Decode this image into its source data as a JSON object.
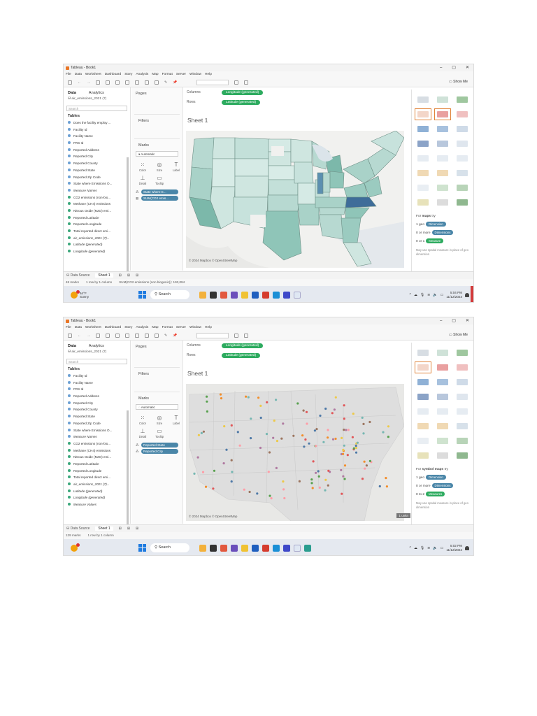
{
  "screens": [
    {
      "window_title": "Tableau - Book1",
      "menu": [
        "File",
        "Data",
        "Worksheet",
        "Dashboard",
        "Story",
        "Analysis",
        "Map",
        "Format",
        "Server",
        "Window",
        "Help"
      ],
      "show_me_label": "Show Me",
      "tabs": {
        "data": "Data",
        "analytics": "Analytics"
      },
      "datasource": "air_emissions_2021 (7)",
      "search_placeholder": "Search",
      "tables_header": "Tables",
      "fields": [
        {
          "label": "Does the facility employ ...",
          "kind": "dim",
          "italic": false
        },
        {
          "label": "Facility Id",
          "kind": "dim",
          "italic": false
        },
        {
          "label": "Facility Name",
          "kind": "dim",
          "italic": false
        },
        {
          "label": "FRS Id",
          "kind": "dim",
          "italic": false
        },
        {
          "label": "Reported Address",
          "kind": "dim",
          "italic": false
        },
        {
          "label": "Reported City",
          "kind": "dim",
          "italic": false
        },
        {
          "label": "Reported County",
          "kind": "dim",
          "italic": false
        },
        {
          "label": "Reported State",
          "kind": "dim",
          "italic": false
        },
        {
          "label": "Reported Zip Code",
          "kind": "dim",
          "italic": false
        },
        {
          "label": "State where Emissions O...",
          "kind": "dim",
          "italic": false
        },
        {
          "label": "Measure Names",
          "kind": "dim",
          "italic": true
        },
        {
          "label": "CO2 emissions (non-bio...",
          "kind": "meas",
          "italic": false
        },
        {
          "label": "Methane (CH4) emissions",
          "kind": "meas",
          "italic": false
        },
        {
          "label": "Nitrous Oxide (N2O) emi...",
          "kind": "meas",
          "italic": false
        },
        {
          "label": "Reported Latitude",
          "kind": "meas",
          "italic": false
        },
        {
          "label": "Reported Longitude",
          "kind": "meas",
          "italic": false
        },
        {
          "label": "Total reported direct emi...",
          "kind": "meas",
          "italic": false
        },
        {
          "label": "air_emissions_2021 (7)...",
          "kind": "meas",
          "italic": true
        },
        {
          "label": "Latitude (generated)",
          "kind": "meas",
          "italic": true
        },
        {
          "label": "Longitude (generated)",
          "kind": "meas",
          "italic": true
        }
      ],
      "pages_label": "Pages",
      "filters_label": "Filters",
      "marks_label": "Marks",
      "mark_type": "Automatic",
      "mark_buttons": [
        "Color",
        "Size",
        "Label",
        "Detail",
        "Tooltip"
      ],
      "mark_pills": [
        {
          "pre": "⁂",
          "text": "State where E..."
        },
        {
          "pre": "▦",
          "text": "SUM(CO2 emis..."
        }
      ],
      "columns_label": "Columns",
      "rows_label": "Rows",
      "columns_pill": "Longitude (generated)",
      "rows_pill": "Latitude (generated)",
      "sheet_title": "Sheet 1",
      "map_attribution": "© 2024 Mapbox © OpenStreetMap",
      "showme_for": "For",
      "showme_kind": "maps",
      "showme_try": "try",
      "showme_lines": [
        {
          "prefix": "1 geo",
          "pill": "Dimension",
          "color": "blue"
        },
        {
          "prefix": "0 or more",
          "pill": "Dimensions",
          "color": "blue"
        },
        {
          "prefix": "0 or 1",
          "pill": "Measure",
          "color": "green"
        }
      ],
      "showme_hint": "May use spatial measure in place of geo dimension",
      "bottom_tabs": {
        "datasource": "Data Source",
        "sheet": "Sheet 1"
      },
      "status": [
        "48 marks",
        "1 row by 1 column",
        "SUM(CO2 emissions (non biogenic)): 193,094"
      ],
      "weather": {
        "temp": "64°F",
        "cond": "Sunny"
      },
      "taskbar_search": "Search",
      "clock": {
        "time": "5:04 PM",
        "date": "11/12/2024"
      }
    },
    {
      "window_title": "Tableau - Book1",
      "menu": [
        "File",
        "Data",
        "Worksheet",
        "Dashboard",
        "Story",
        "Analysis",
        "Map",
        "Format",
        "Server",
        "Window",
        "Help"
      ],
      "show_me_label": "Show Me",
      "tabs": {
        "data": "Data",
        "analytics": "Analytics"
      },
      "datasource": "air_emissions_2021 (7)",
      "search_placeholder": "Search",
      "tables_header": "Tables",
      "fields": [
        {
          "label": "Facility Id",
          "kind": "dim",
          "italic": false
        },
        {
          "label": "Facility Name",
          "kind": "dim",
          "italic": false
        },
        {
          "label": "FRS Id",
          "kind": "dim",
          "italic": false
        },
        {
          "label": "Reported Address",
          "kind": "dim",
          "italic": false
        },
        {
          "label": "Reported City",
          "kind": "dim",
          "italic": false
        },
        {
          "label": "Reported County",
          "kind": "dim",
          "italic": false
        },
        {
          "label": "Reported State",
          "kind": "dim",
          "italic": false
        },
        {
          "label": "Reported Zip Code",
          "kind": "dim",
          "italic": false
        },
        {
          "label": "State where Emissions O...",
          "kind": "dim",
          "italic": false
        },
        {
          "label": "Measure Names",
          "kind": "dim",
          "italic": true
        },
        {
          "label": "CO2 emissions (non-bio...",
          "kind": "meas",
          "italic": false
        },
        {
          "label": "Methane (CH4) emissions",
          "kind": "meas",
          "italic": false
        },
        {
          "label": "Nitrous Oxide (N2O) emi...",
          "kind": "meas",
          "italic": false
        },
        {
          "label": "Reported Latitude",
          "kind": "meas",
          "italic": false
        },
        {
          "label": "Reported Longitude",
          "kind": "meas",
          "italic": false
        },
        {
          "label": "Total reported direct emi...",
          "kind": "meas",
          "italic": false
        },
        {
          "label": "air_emissions_2021 (7)...",
          "kind": "meas",
          "italic": true
        },
        {
          "label": "Latitude (generated)",
          "kind": "meas",
          "italic": true
        },
        {
          "label": "Longitude (generated)",
          "kind": "meas",
          "italic": true
        },
        {
          "label": "Measure Values",
          "kind": "meas",
          "italic": true
        }
      ],
      "pages_label": "Pages",
      "filters_label": "Filters",
      "marks_label": "Marks",
      "mark_type": "Automatic",
      "mark_buttons": [
        "Color",
        "Size",
        "Label",
        "Detail",
        "Tooltip"
      ],
      "mark_pills": [
        {
          "pre": "⁂",
          "text": "Reported State"
        },
        {
          "pre": "⁂",
          "text": "Reported City"
        }
      ],
      "columns_label": "Columns",
      "rows_label": "Rows",
      "columns_pill": "Longitude (generated)",
      "rows_pill": "Latitude (generated)",
      "sheet_title": "Sheet 1",
      "map_attribution": "© 2024 Mapbox © OpenStreetMap",
      "map_banner": "1 unkn",
      "showme_for": "For",
      "showme_kind": "symbol maps",
      "showme_try": "try",
      "showme_lines": [
        {
          "prefix": "1 geo",
          "pill": "Dimension",
          "color": "blue"
        },
        {
          "prefix": "0 or more",
          "pill": "Dimensions",
          "color": "blue"
        },
        {
          "prefix": "0 to 2",
          "pill": "Measures",
          "color": "green"
        }
      ],
      "showme_hint": "May use spatial measure in place of geo dimension",
      "bottom_tabs": {
        "datasource": "Data Source",
        "sheet": "Sheet 1"
      },
      "status": [
        "129 marks",
        "1 row by 1 column"
      ],
      "weather": {
        "temp": "",
        "cond": ""
      },
      "taskbar_search": "Search",
      "clock": {
        "time": "5:02 PM",
        "date": "11/12/2024"
      }
    }
  ],
  "colors": {
    "accent_green": "#2dab5f",
    "pill_blue": "#4a86a8",
    "choropleth_light": "#cfe6e0",
    "choropleth_mid": "#9bcbc0",
    "choropleth_dark": "#3f6d99",
    "showme_selected": "#e0843a"
  }
}
